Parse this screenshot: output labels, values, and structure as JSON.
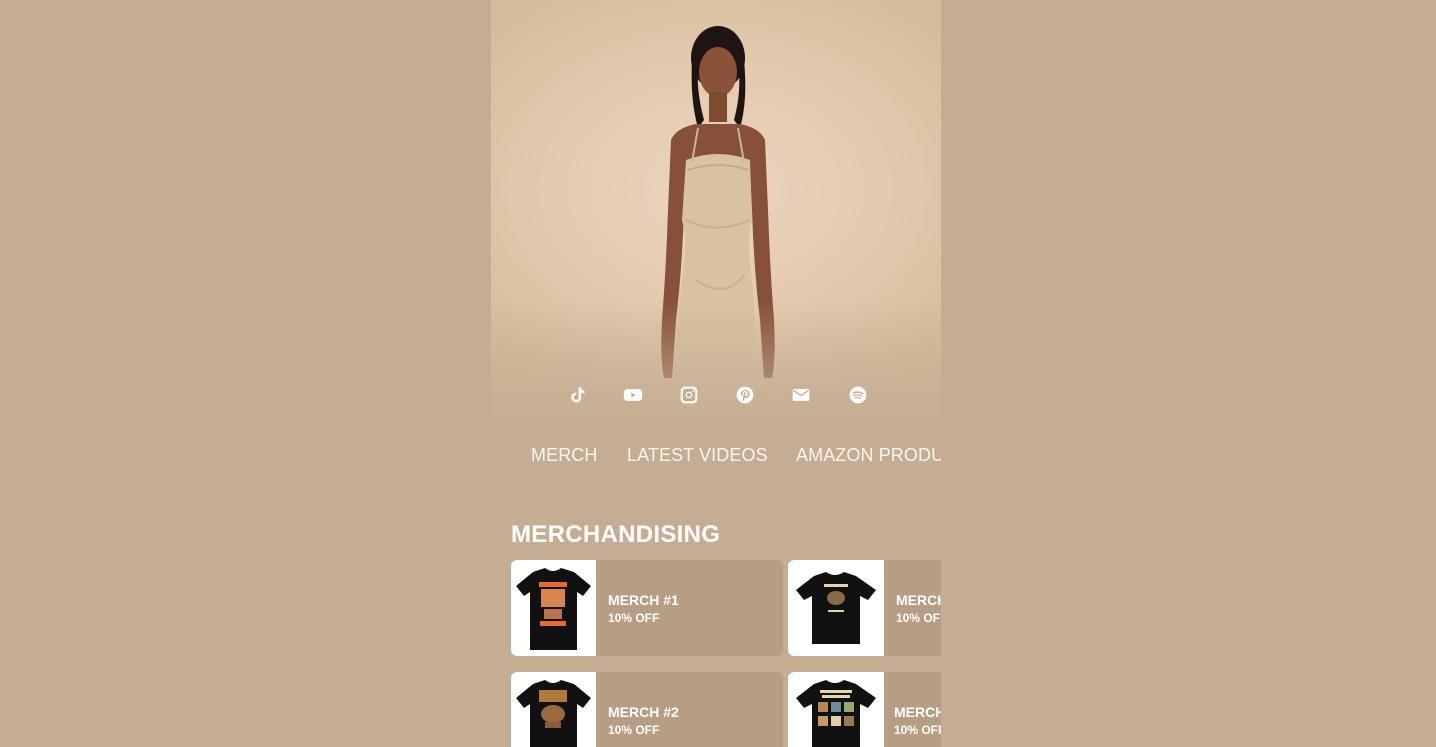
{
  "social_icons": [
    "tiktok-icon",
    "youtube-icon",
    "instagram-icon",
    "pinterest-icon",
    "email-icon",
    "spotify-icon"
  ],
  "tabs": [
    {
      "label": "MERCH"
    },
    {
      "label": "LATEST VIDEOS"
    },
    {
      "label": "AMAZON PRODU"
    }
  ],
  "section": {
    "title": "MERCHANDISING"
  },
  "merch": [
    {
      "name": "MERCH #1",
      "discount": "10% OFF"
    },
    {
      "name": "MERCH",
      "discount": "10% OF"
    },
    {
      "name": "MERCH #2",
      "discount": "10% OFF"
    },
    {
      "name": "MERCH",
      "discount": "10% OFF"
    }
  ],
  "colors": {
    "background": "#c4ad92",
    "card": "#b59e83",
    "text": "#ffffff"
  }
}
